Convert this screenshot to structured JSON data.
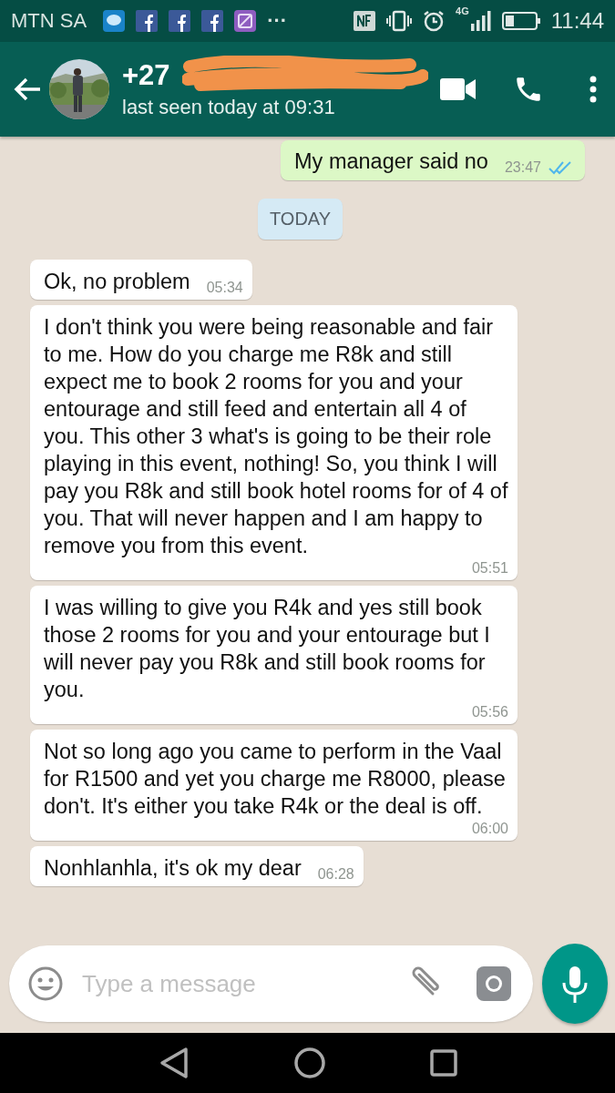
{
  "status_bar": {
    "carrier": "MTN SA",
    "more_notifications": "···",
    "network": "4G",
    "time": "11:44"
  },
  "header": {
    "title": "+27",
    "subtitle": "last seen today at 09:31",
    "redacted": true
  },
  "messages": [
    {
      "kind": "outgoing",
      "text": "My manager said no",
      "time": "23:47",
      "read": true
    },
    {
      "kind": "date",
      "text": "TODAY"
    },
    {
      "kind": "incoming",
      "text": "Ok, no problem",
      "time": "05:34"
    },
    {
      "kind": "incoming",
      "text": "I don't think you were being reasonable and fair to me. How do you charge me R8k and still expect me to book 2 rooms for you and your entourage and still feed and entertain all 4 of you.  This other 3 what's is going to be their role playing in this event, nothing! So, you think I will pay you R8k and still book hotel rooms for of 4 of you. That will never happen and I am happy to remove you from this event.",
      "time": "05:51"
    },
    {
      "kind": "incoming",
      "text": "I was willing to give you R4k and yes still book those 2 rooms for you and your entourage but I will never pay you R8k and still book rooms for you.",
      "time": "05:56"
    },
    {
      "kind": "incoming",
      "text": "Not so long ago you came to perform in the Vaal for R1500 and yet you charge me R8000, please don't. It's either you take R4k or the deal is off.",
      "time": "06:00"
    },
    {
      "kind": "incoming",
      "text": "Nonhlanhla, it's ok my dear",
      "time": "06:28"
    }
  ],
  "composer": {
    "placeholder": "Type a message"
  }
}
